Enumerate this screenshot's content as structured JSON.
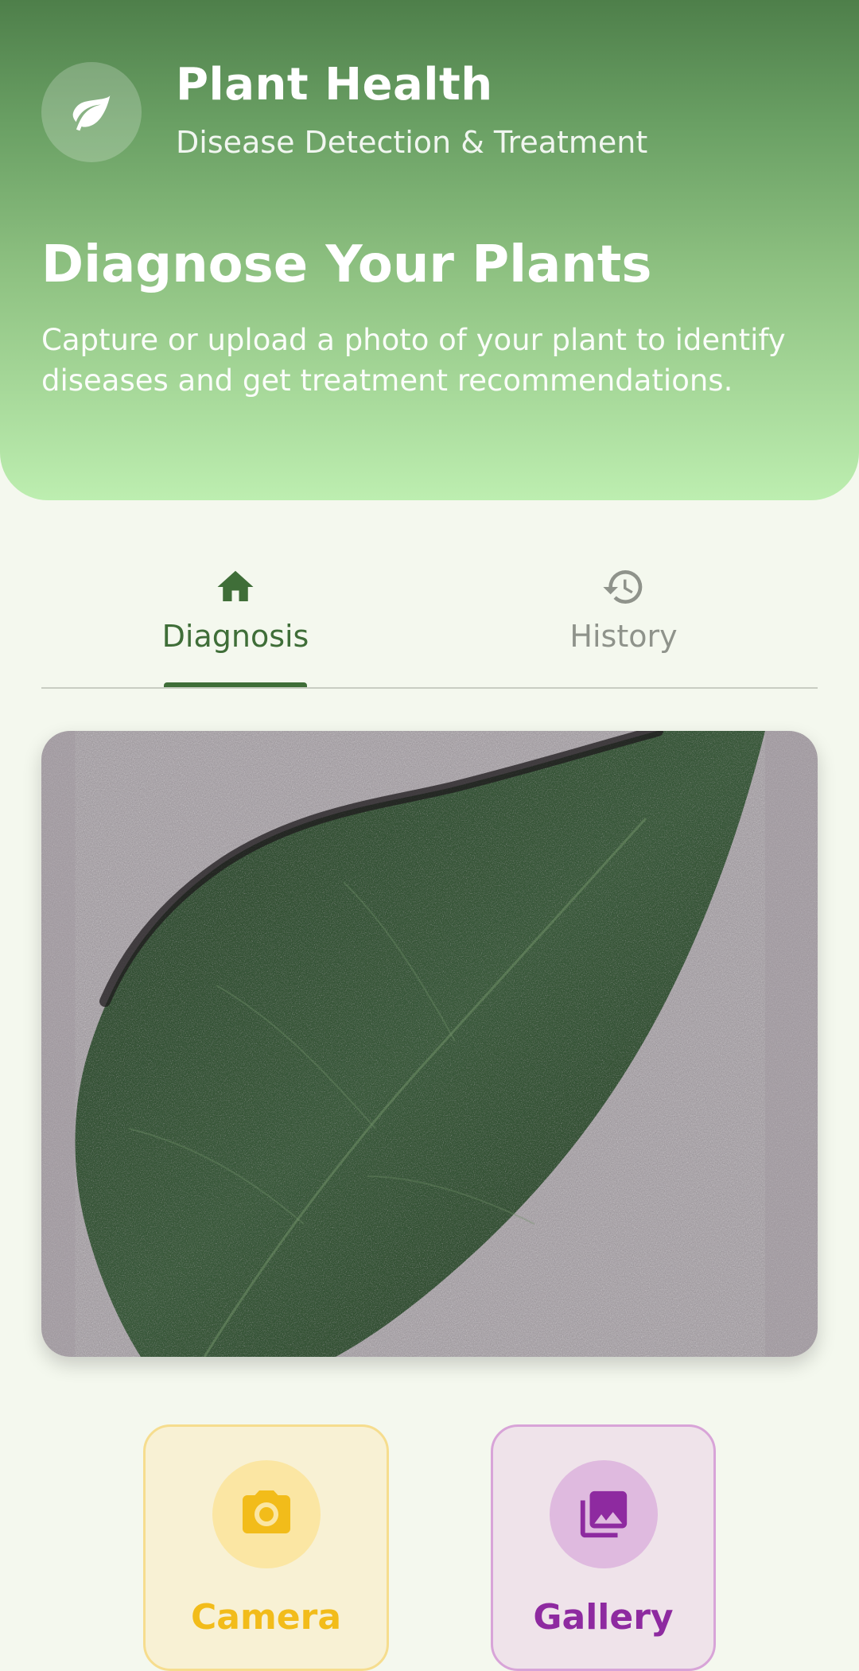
{
  "header": {
    "app_title": "Plant Health",
    "app_subtitle": "Disease Detection & Treatment",
    "brand_icon": "leaf-icon",
    "hero_title": "Diagnose Your Plants",
    "hero_description": "Capture or upload a photo of your plant to identify diseases and get treatment recommendations."
  },
  "tabs": [
    {
      "label": "Diagnosis",
      "icon": "home-icon",
      "active": true
    },
    {
      "label": "History",
      "icon": "history-icon",
      "active": false
    }
  ],
  "preview": {
    "description": "leaf-photo"
  },
  "actions": {
    "camera": {
      "label": "Camera",
      "icon": "camera-icon",
      "color": "#f2bc1a"
    },
    "gallery": {
      "label": "Gallery",
      "icon": "gallery-icon",
      "color": "#8e2aa0"
    }
  },
  "colors": {
    "primary": "#3f6e38",
    "header_top": "#4e7f4a",
    "header_bottom": "#bdeeb0",
    "background": "#f4f8ee",
    "inactive": "#8f938b"
  }
}
